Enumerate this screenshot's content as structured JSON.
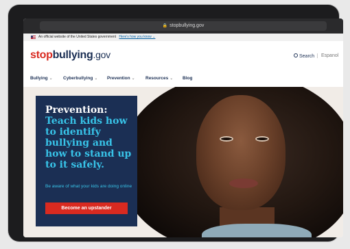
{
  "browser": {
    "url": "stopbullying.gov"
  },
  "gov_banner": {
    "text": "An official website of the United States government",
    "link": "Here's how you know ⌄"
  },
  "header": {
    "logo_stop": "stop",
    "logo_bullying": "bullying",
    "logo_gov": ".gov",
    "search_label": "Search",
    "language_label": "Espanol"
  },
  "nav": {
    "items": [
      {
        "label": "Bullying",
        "chevron": "⌄"
      },
      {
        "label": "Cyberbullying",
        "chevron": "⌄"
      },
      {
        "label": "Prevention",
        "chevron": "⌄"
      },
      {
        "label": "Resources",
        "chevron": "⌄"
      },
      {
        "label": "Blog",
        "chevron": ""
      }
    ]
  },
  "hero": {
    "title_white": "Prevention:",
    "title_blue": "Teach kids how to identify bullying and how to stand up to it safely.",
    "subtitle": "Be aware of what your kids are doing online",
    "cta_label": "Become an upstander"
  },
  "colors": {
    "brand_red": "#d92a20",
    "brand_navy": "#1b2f54",
    "accent_blue": "#38c3e8"
  }
}
